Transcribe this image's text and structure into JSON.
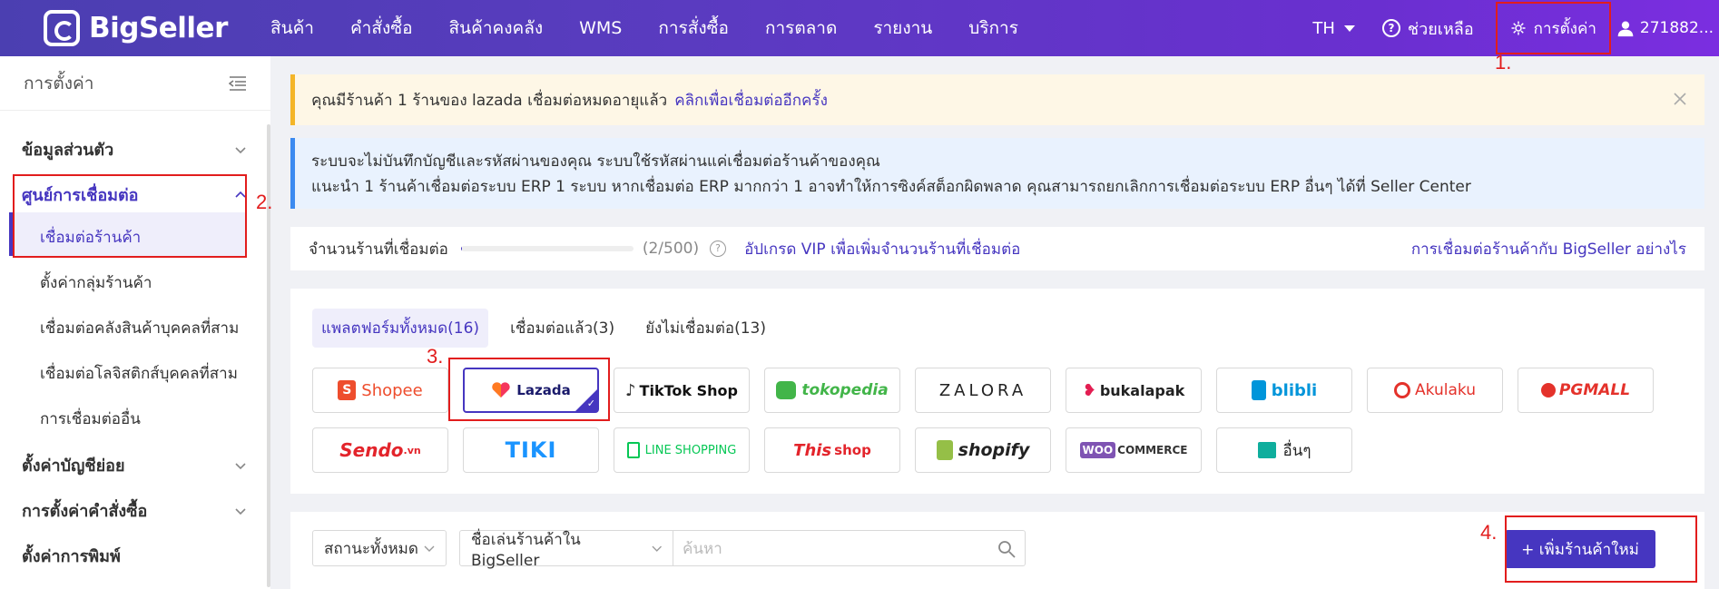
{
  "header": {
    "logo": "BigSeller",
    "nav": [
      "สินค้า",
      "คำสั่งซื้อ",
      "สินค้าคงคลัง",
      "WMS",
      "การสั่งซื้อ",
      "การตลาด",
      "รายงาน",
      "บริการ"
    ],
    "lang": "TH",
    "help": "ช่วยเหลือ",
    "settings": "การตั้งค่า",
    "user": "271882..."
  },
  "annotations": {
    "a1": "1.",
    "a2": "2.",
    "a3": "3.",
    "a4": "4."
  },
  "sidebar": {
    "title": "การตั้งค่า",
    "groups": [
      "ข้อมูลส่วนตัว",
      "ศูนย์การเชื่อมต่อ",
      "ตั้งค่าบัญชีย่อย",
      "การตั้งค่าคำสั่งซื้อ",
      "ตั้งค่าการพิมพ์"
    ],
    "subitems": [
      "เชื่อมต่อร้านค้า",
      "ตั้งค่ากลุ่มร้านค้า",
      "เชื่อมต่อคลังสินค้าบุคคลที่สาม",
      "เชื่อมต่อโลจิสติกส์บุคคลที่สาม",
      "การเชื่อมต่ออื่น"
    ]
  },
  "notice": {
    "text": "คุณมีร้านค้า 1 ร้านของ lazada เชื่อมต่อหมดอายุแล้ว",
    "link": "คลิกเพื่อเชื่อมต่ออีกครั้ง"
  },
  "info": {
    "line1": "ระบบจะไม่บันทึกบัญชีและรหัสผ่านของคุณ ระบบใช้รหัสผ่านแค่เชื่อมต่อร้านค้าของคุณ",
    "line2": "แนะนำ 1 ร้านค้าเชื่อมต่อระบบ ERP 1 ระบบ หากเชื่อมต่อ ERP มากกว่า 1 อาจทำให้การซิงค์สต็อกผิดพลาด คุณสามารถยกเลิกการเชื่อมต่อระบบ ERP อื่นๆ ได้ที่ Seller Center"
  },
  "quota": {
    "label": "จำนวนร้านที่เชื่อมต่อ",
    "count": "(2/500)",
    "fill": 0.004,
    "upgrade": "อัปเกรด VIP เพื่อเพิ่มจำนวนร้านที่เชื่อมต่อ",
    "howto": "การเชื่อมต่อร้านค้ากับ BigSeller อย่างไร"
  },
  "platform_tabs": [
    "แพลตฟอร์มทั้งหมด(16)",
    "เชื่อมต่อแล้ว(3)",
    "ยังไม่เชื่อมต่อ(13)"
  ],
  "platforms": {
    "shopee": "Shopee",
    "lazada": "Lazada",
    "tiktok": "TikTok Shop",
    "tokopedia": "tokopedia",
    "zalora": "ZALORA",
    "bukalapak": "bukalapak",
    "blibli": "blibli",
    "akulaku": "Akulaku",
    "pgmall": "PGMALL",
    "sendo": "Sendo",
    "sendo_vn": ".vn",
    "tiki": "TIKI",
    "line": "LINE SHOPPING",
    "thisshop_this": "This",
    "thisshop_shop": "shop",
    "shopify": "shopify",
    "woo_a": "WOO",
    "woo_b": "COMMERCE",
    "other": "อื่นๆ"
  },
  "filters": {
    "status": "สถานะทั้งหมด",
    "field": "ชื่อเล่นร้านค้าใน BigSeller",
    "search_placeholder": "ค้นหา",
    "add": "+ เพิ่มร้านค้าใหม่"
  },
  "colors": {
    "accent": "#4636c0",
    "annotation": "#e21d1d"
  }
}
